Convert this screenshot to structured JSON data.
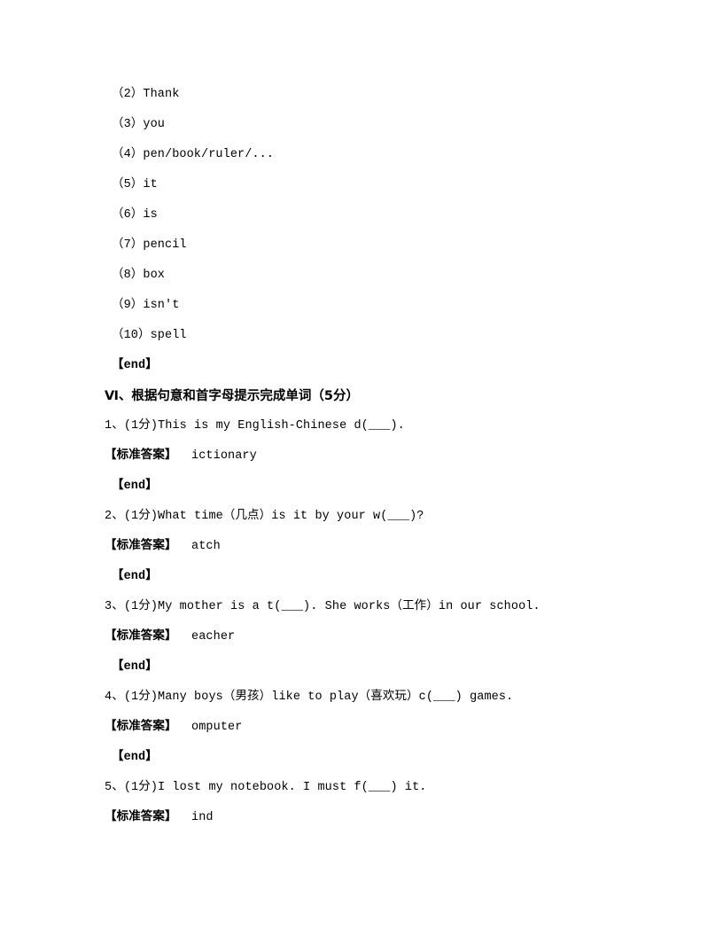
{
  "document": {
    "type": "exam-answer-key",
    "background_color": "#ffffff",
    "text_color": "#000000"
  },
  "previous_section": {
    "answer_items": [
      "（2）Thank",
      "（3）you",
      "（4）pen/book/ruler/...",
      "（5）it",
      "（6）is",
      "（7）pencil",
      "（8）box",
      "（9）isn't",
      "（10）spell"
    ],
    "end_marker": "【end】"
  },
  "section": {
    "numeral": "Ⅵ",
    "heading": "Ⅵ、根据句意和首字母提示完成单词（5分）",
    "answer_label": "【标准答案】",
    "end_marker": "【end】",
    "questions": [
      {
        "number": "1、",
        "points": "(1分)",
        "text": "This is my English-Chinese d(___).",
        "answer": "ictionary"
      },
      {
        "number": "2、",
        "points": "(1分)",
        "text": "What time（几点）is it by your w(___)?",
        "answer": "atch"
      },
      {
        "number": "3、",
        "points": "(1分)",
        "text": "My mother is a t(___). She works（工作）in our school.",
        "answer": "eacher"
      },
      {
        "number": "4、",
        "points": "(1分)",
        "text": "Many boys（男孩）like to play（喜欢玩）c(___) games.",
        "answer": "omputer"
      },
      {
        "number": "5、",
        "points": "(1分)",
        "text": "I lost my notebook. I must f(___) it.",
        "answer": "ind"
      }
    ]
  }
}
